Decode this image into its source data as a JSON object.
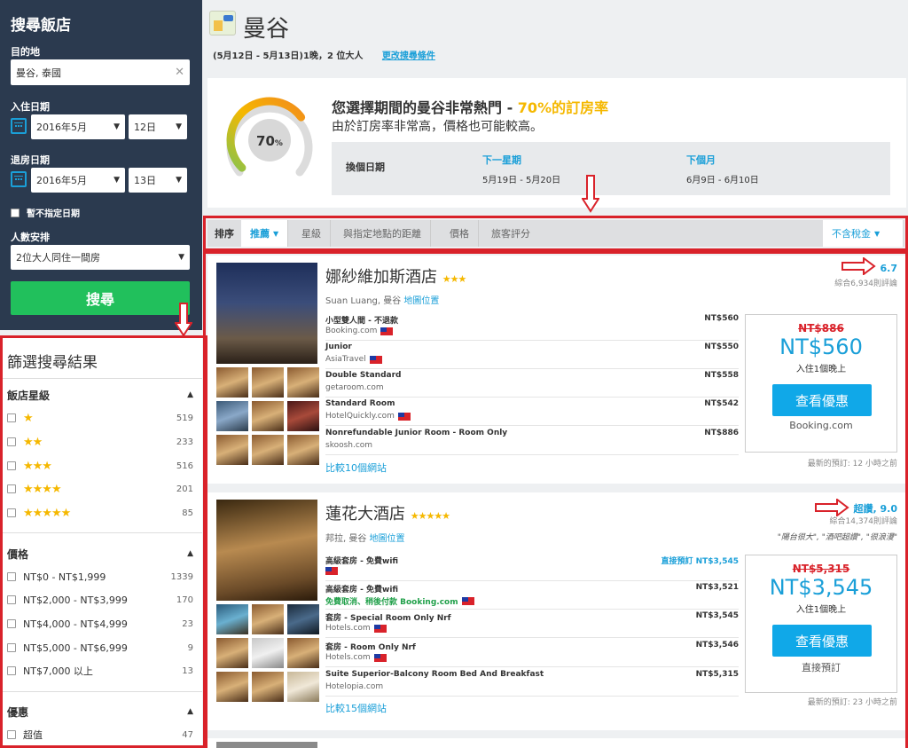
{
  "search": {
    "heading": "搜尋飯店",
    "destination_label": "目的地",
    "destination_value": "曼谷, 泰國",
    "checkin_label": "入住日期",
    "checkin_month": "2016年5月",
    "checkin_day": "12日",
    "checkout_label": "退房日期",
    "checkout_month": "2016年5月",
    "checkout_day": "13日",
    "no_dates_label": "暫不指定日期",
    "guests_label": "人數安排",
    "guests_value": "2位大人同住一間房",
    "search_button": "搜尋"
  },
  "filter": {
    "title": "篩選搜尋結果",
    "stars_heading": "飯店星級",
    "stars": [
      {
        "stars": "★",
        "count": "519"
      },
      {
        "stars": "★★",
        "count": "233"
      },
      {
        "stars": "★★★",
        "count": "516"
      },
      {
        "stars": "★★★★",
        "count": "201"
      },
      {
        "stars": "★★★★★",
        "count": "85"
      }
    ],
    "price_heading": "價格",
    "prices": [
      {
        "label": "NT$0 - NT$1,999",
        "count": "1339"
      },
      {
        "label": "NT$2,000 - NT$3,999",
        "count": "170"
      },
      {
        "label": "NT$4,000 - NT$4,999",
        "count": "23"
      },
      {
        "label": "NT$5,000 - NT$6,999",
        "count": "9"
      },
      {
        "label": "NT$7,000 以上",
        "count": "13"
      }
    ],
    "deals_heading": "優惠",
    "deals": [
      {
        "label": "超值",
        "count": "47"
      }
    ]
  },
  "header": {
    "city": "曼谷",
    "summary": "(5月12日 - 5月13日)1晚，2 位大人",
    "change_link": "更改搜尋條件"
  },
  "popular": {
    "gauge_value": "70",
    "gauge_unit": "%",
    "gauge_fraction": 0.7,
    "title_prefix": "您選擇期間的曼谷非常熱門 - ",
    "title_highlight": "70%的訂房率",
    "subtitle": "由於訂房率非常高，價格也可能較高。",
    "change_dates": "換個日期",
    "next_week_label": "下一星期",
    "next_week_dates": "5月19日 - 5月20日",
    "next_month_label": "下個月",
    "next_month_dates": "6月9日 - 6月10日"
  },
  "sort": {
    "label": "排序",
    "tabs": [
      "推薦",
      "星級",
      "與指定地點的距離",
      "價格",
      "旅客評分"
    ],
    "tax": "不含稅金"
  },
  "hotels": [
    {
      "name": "娜紗維加斯酒店",
      "stars": "★★★",
      "location": "Suan Luang, 曼谷",
      "map_link": "地圖位置",
      "rating": "6.7",
      "reviews": "綜合6,934則評論",
      "deals": [
        {
          "name": "小型雙人間 - 不退款",
          "site": "Booking.com",
          "price": "NT$560",
          "flag": true
        },
        {
          "name": "Junior",
          "site": "AsiaTravel",
          "price": "NT$550",
          "flag": true
        },
        {
          "name": "Double Standard",
          "site": "getaroom.com",
          "price": "NT$558",
          "flag": false
        },
        {
          "name": "Standard Room",
          "site": "HotelQuickly.com",
          "price": "NT$542",
          "flag": true
        },
        {
          "name": "Nonrefundable Junior Room - Room Only",
          "site": "skoosh.com",
          "price": "NT$886",
          "flag": false
        }
      ],
      "compare": "比較10個網站",
      "old_price": "NT$886",
      "price": "NT$560",
      "price_note": "入住1個晚上",
      "button": "查看優惠",
      "vendor": "Booking.com",
      "updated": "最新的預訂: 12 小時之前"
    },
    {
      "name": "蓮花大酒店",
      "stars": "★★★★★",
      "location": "邦拉, 曼谷",
      "map_link": "地圖位置",
      "rating": "超讚, 9.0",
      "reviews": "綜合14,374則評論",
      "quotes": "\"陽台很大\", \"酒吧超讚\", \"很浪漫\"",
      "deals": [
        {
          "name": "高級套房 - 免費wifi",
          "site": "",
          "price": "直接預訂 NT$3,545",
          "flag": true
        },
        {
          "name": "高級套房 - 免費wifi",
          "site": "免費取消、稍後付款 Booking.com",
          "price": "NT$3,521",
          "flag": true
        },
        {
          "name": "套房 - Special Room Only Nrf",
          "site": "Hotels.com",
          "price": "NT$3,545",
          "flag": true
        },
        {
          "name": "套房 - Room Only Nrf",
          "site": "Hotels.com",
          "price": "NT$3,546",
          "flag": true
        },
        {
          "name": "Suite Superior-Balcony Room Bed And Breakfast",
          "site": "Hotelopia.com",
          "price": "NT$5,315",
          "flag": false
        }
      ],
      "compare": "比較15個網站",
      "old_price": "NT$5,315",
      "price": "NT$3,545",
      "price_note": "入住1個晚上",
      "button": "查看優惠",
      "vendor": "直接預訂",
      "updated": "最新的預訂: 23 小時之前"
    }
  ]
}
